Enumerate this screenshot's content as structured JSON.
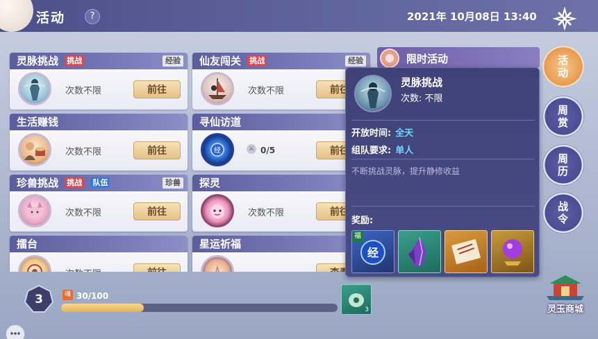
{
  "header": {
    "title": "活动",
    "help": "?",
    "datetime": "2021年 10月08日 13:40"
  },
  "cards": [
    {
      "name": "灵脉挑战",
      "tags": [
        "挑战"
      ],
      "tag_colors": [
        "red"
      ],
      "right_tag": "经验",
      "status": "次数不限",
      "button": "前往",
      "icon": "ghost-warrior-icon"
    },
    {
      "name": "仙友闯关",
      "tags": [
        "挑战"
      ],
      "tag_colors": [
        "red"
      ],
      "right_tag": "经验",
      "status": "次数不限",
      "button": "前往",
      "icon": "ship-warrior-icon"
    },
    {
      "name": "生活赚钱",
      "tags": [],
      "tag_colors": [],
      "right_tag": "",
      "status": "次数不限",
      "button": "前往",
      "icon": "merchant-icon"
    },
    {
      "name": "寻仙访道",
      "tags": [],
      "tag_colors": [],
      "right_tag": "",
      "status": "0/5",
      "button": "前往",
      "icon": "experience-orb-icon"
    },
    {
      "name": "珍兽挑战",
      "tags": [
        "挑战",
        "队伍"
      ],
      "tag_colors": [
        "red",
        "blue"
      ],
      "right_tag": "珍兽",
      "status": "次数不限",
      "button": "前往",
      "icon": "pink-beast-icon"
    },
    {
      "name": "探灵",
      "tags": [],
      "tag_colors": [],
      "right_tag": "",
      "status": "次数不限",
      "button": "前往",
      "icon": "spirit-face-icon"
    },
    {
      "name": "擂台",
      "tags": [],
      "tag_colors": [],
      "right_tag": "",
      "status": "次数不限",
      "button": "前往",
      "icon": "arena-icon"
    },
    {
      "name": "星运祈福",
      "tags": [],
      "tag_colors": [],
      "right_tag": "",
      "status": "",
      "button": "查看",
      "icon": "prayer-icon"
    }
  ],
  "limited": {
    "title": "限时活动"
  },
  "popup": {
    "name": "灵脉挑战",
    "count_label": "次数: 不限",
    "open_time_label": "开放时间:",
    "open_time": "全天",
    "team_label": "组队要求:",
    "team": "单人",
    "description": "不断挑战灵脉，提升静修收益",
    "reward_label": "奖励:",
    "reward_badge": "福",
    "rewards": [
      "exp-orb-icon",
      "purple-crystal-icon",
      "scroll-map-icon",
      "purple-pearl-icon"
    ]
  },
  "side_nav": [
    {
      "label": "活动",
      "active": true
    },
    {
      "label": "周赏",
      "active": false
    },
    {
      "label": "周历",
      "active": false
    },
    {
      "label": "战令",
      "active": false
    }
  ],
  "shop": {
    "label": "灵玉商城"
  },
  "bottom": {
    "level": "3",
    "progress_text": "30/100",
    "progress_fraction": 0.3,
    "badge_text": "魂",
    "item_count": "3"
  },
  "colors": {
    "accent": "#6fd6ff",
    "tag_red": "#d74a55",
    "tag_blue": "#3c78d6",
    "button": "#e4c185"
  }
}
